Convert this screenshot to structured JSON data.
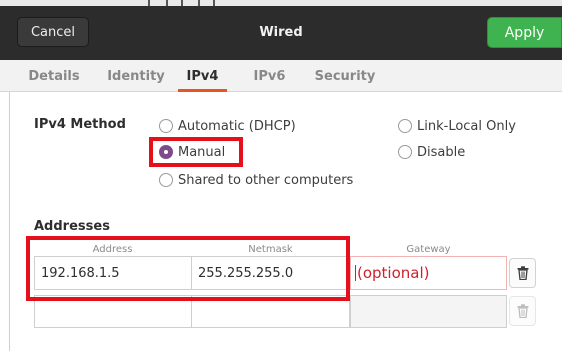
{
  "header": {
    "cancel_label": "Cancel",
    "title": "Wired",
    "apply_label": "Apply"
  },
  "tabs": [
    {
      "label": "Details",
      "active": false
    },
    {
      "label": "Identity",
      "active": false
    },
    {
      "label": "IPv4",
      "active": true
    },
    {
      "label": "IPv6",
      "active": false
    },
    {
      "label": "Security",
      "active": false
    }
  ],
  "ipv4_method": {
    "label": "IPv4 Method",
    "options": [
      {
        "label": "Automatic (DHCP)",
        "checked": false
      },
      {
        "label": "Manual",
        "checked": true
      },
      {
        "label": "Shared to other computers",
        "checked": false
      },
      {
        "label": "Link-Local Only",
        "checked": false
      },
      {
        "label": "Disable",
        "checked": false
      }
    ]
  },
  "addresses": {
    "label": "Addresses",
    "columns": [
      "Address",
      "Netmask",
      "Gateway"
    ],
    "rows": [
      {
        "address": "192.168.1.5",
        "netmask": "255.255.255.0",
        "gateway": "(optional)"
      },
      {
        "address": "",
        "netmask": "",
        "gateway": ""
      }
    ]
  },
  "colors": {
    "accent": "#e95420",
    "apply": "#3eb34f",
    "radio_checked": "#7e4a8a",
    "highlight": "#e4101c"
  },
  "icons": {
    "trash": "trash-icon"
  }
}
